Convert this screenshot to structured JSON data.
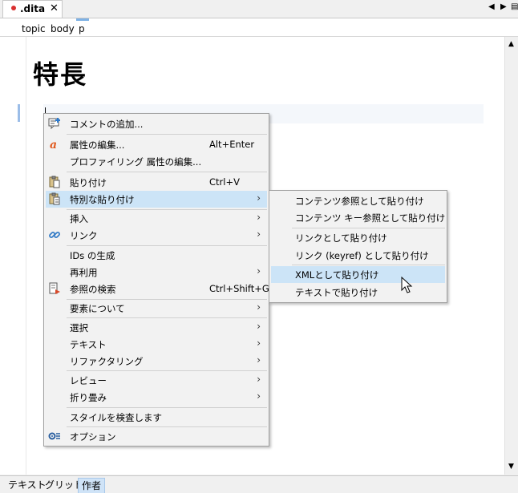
{
  "tab": {
    "name": ".dita",
    "close": "✕"
  },
  "tabnav": {
    "prev": "◀",
    "next": "▶",
    "menu": "▤"
  },
  "breadcrumb": [
    "topic",
    "body",
    "p"
  ],
  "document": {
    "heading": "特長"
  },
  "scroll": {
    "up": "▲",
    "down": "▼"
  },
  "bottom_tabs": [
    "テキスト",
    "グリッド",
    "作者"
  ],
  "active_bottom_tab": "作者",
  "context_menu": {
    "items": [
      {
        "label": "コメントの追加...",
        "icon": "comment-add-icon"
      },
      {
        "label": "属性の編集...",
        "shortcut": "Alt+Enter",
        "icon": "attribute-icon"
      },
      {
        "label": "プロファイリング 属性の編集..."
      },
      {
        "label": "貼り付け",
        "shortcut": "Ctrl+V",
        "icon": "paste-icon"
      },
      {
        "label": "特別な貼り付け",
        "submenu": true,
        "icon": "paste-special-icon",
        "highlighted": true
      },
      {
        "label": "挿入",
        "submenu": true
      },
      {
        "label": "リンク",
        "submenu": true,
        "icon": "link-icon"
      },
      {
        "label": "IDs の生成"
      },
      {
        "label": "再利用",
        "submenu": true
      },
      {
        "label": "参照の検索",
        "shortcut": "Ctrl+Shift+G",
        "icon": "search-references-icon"
      },
      {
        "label": "要素について",
        "submenu": true
      },
      {
        "label": "選択",
        "submenu": true
      },
      {
        "label": "テキスト",
        "submenu": true
      },
      {
        "label": "リファクタリング",
        "submenu": true
      },
      {
        "label": "レビュー",
        "submenu": true
      },
      {
        "label": "折り畳み",
        "submenu": true
      },
      {
        "label": "スタイルを検査します"
      },
      {
        "label": "オプション",
        "icon": "options-icon"
      }
    ]
  },
  "paste_special_submenu": {
    "items": [
      {
        "label": "コンテンツ参照として貼り付け"
      },
      {
        "label": "コンテンツ キー参照として貼り付け"
      },
      {
        "label": "リンクとして貼り付け"
      },
      {
        "label": "リンク (keyref) として貼り付け"
      },
      {
        "label": "XMLとして貼り付け",
        "highlighted": true
      },
      {
        "label": "テキストで貼り付け"
      }
    ]
  },
  "colors": {
    "highlight": "#cce4f7",
    "menu_bg": "#f2f2f2",
    "attribute_icon": "#e05a1e",
    "link_icon": "#3a7fc8",
    "modified_dot": "#d93030"
  }
}
